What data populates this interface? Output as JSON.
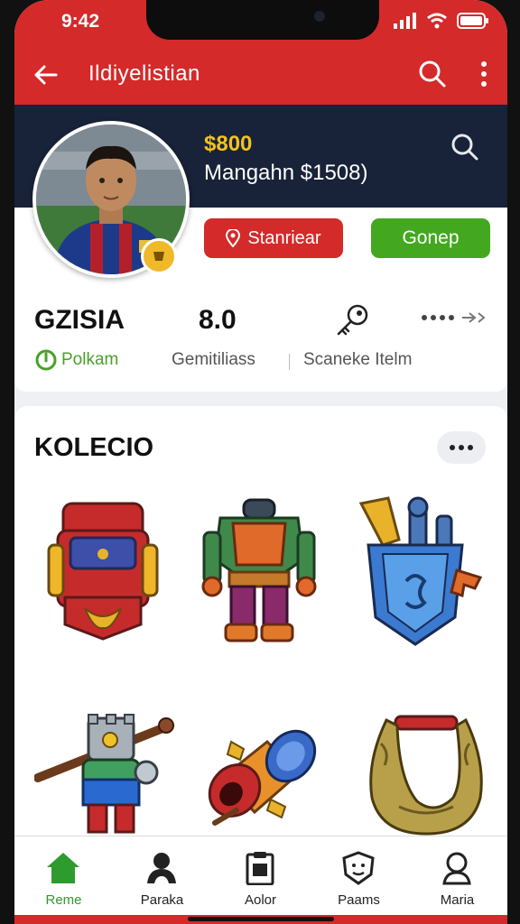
{
  "status": {
    "time": "9:42"
  },
  "appbar": {
    "title": "Ildiyelistian"
  },
  "profile": {
    "coins": "$800",
    "subtitle": "Mangahn $1508)",
    "primary_button": "Stanriear",
    "secondary_button": "Gonep"
  },
  "stats": [
    {
      "value": "GZISIA",
      "label": "Polkam"
    },
    {
      "value": "8.0",
      "label": "Gemitiliass"
    },
    {
      "value": "",
      "label": "Scaneke Itelm"
    }
  ],
  "collection": {
    "title": "KOLECIO",
    "items": [
      {
        "icon": "backpack-icon"
      },
      {
        "icon": "armor-suit-icon"
      },
      {
        "icon": "shield-quiver-icon"
      },
      {
        "icon": "knight-warrior-icon"
      },
      {
        "icon": "cannon-icon"
      },
      {
        "icon": "rope-sling-icon"
      }
    ]
  },
  "tabs": [
    {
      "label": "Reme",
      "icon": "home-icon",
      "active": true
    },
    {
      "label": "Paraka",
      "icon": "person-icon",
      "active": false
    },
    {
      "label": "Aolor",
      "icon": "clipboard-icon",
      "active": false
    },
    {
      "label": "Paams",
      "icon": "badge-face-icon",
      "active": false
    },
    {
      "label": "Maria",
      "icon": "user-circle-icon",
      "active": false
    }
  ],
  "colors": {
    "brand_red": "#d42a2a",
    "navy": "#182238",
    "green": "#43a81f",
    "gold": "#f1c31c"
  }
}
